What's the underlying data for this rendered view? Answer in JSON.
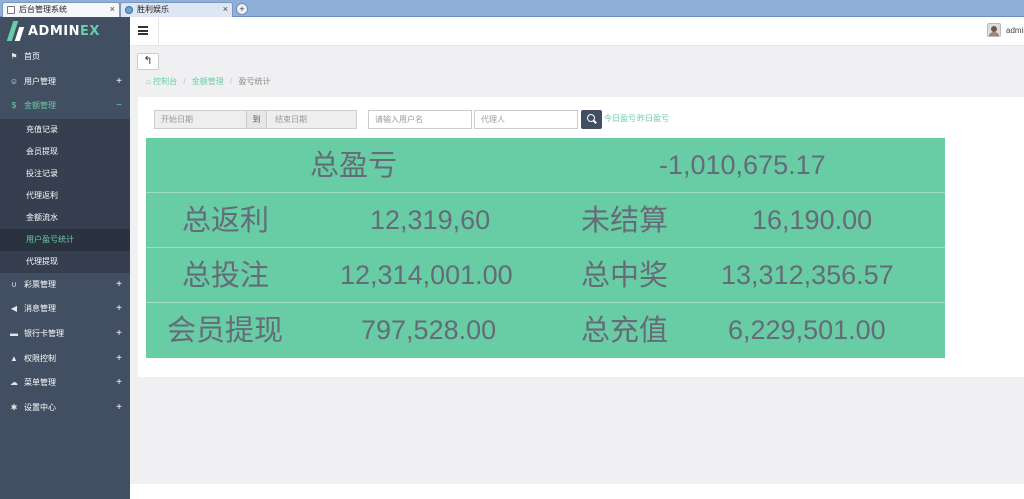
{
  "browser": {
    "tabs": [
      {
        "title": "后台管理系统",
        "close": "×"
      },
      {
        "title": "胜利娱乐",
        "close": "×"
      }
    ],
    "new_tab": "+"
  },
  "sidebar": {
    "brand": {
      "prefix": "ADMIN",
      "suffix": "EX"
    },
    "items": [
      {
        "label": "首页",
        "icon": "flag-icon",
        "glyph": "⚑",
        "expandable": false
      },
      {
        "label": "用户管理",
        "icon": "user-icon",
        "glyph": "☺",
        "expandable": true,
        "toggle": "+"
      },
      {
        "label": "金额管理",
        "icon": "dollar-icon",
        "glyph": "$",
        "expandable": true,
        "toggle": "−",
        "open": true,
        "children": [
          "充值记录",
          "会员提现",
          "投注记录",
          "代理返利",
          "金额流水",
          "用户盈亏统计",
          "代理提现"
        ],
        "active_child": "用户盈亏统计"
      },
      {
        "label": "彩票管理",
        "icon": "magnet-icon",
        "glyph": "∪",
        "expandable": true,
        "toggle": "+"
      },
      {
        "label": "消息管理",
        "icon": "bullhorn-icon",
        "glyph": "◀",
        "expandable": true,
        "toggle": "+"
      },
      {
        "label": "银行卡管理",
        "icon": "briefcase-icon",
        "glyph": "▬",
        "expandable": true,
        "toggle": "+"
      },
      {
        "label": "权限控制",
        "icon": "lock-icon",
        "glyph": "▲",
        "expandable": true,
        "toggle": "+"
      },
      {
        "label": "菜单管理",
        "icon": "cloud-icon",
        "glyph": "☁",
        "expandable": true,
        "toggle": "+"
      },
      {
        "label": "设置中心",
        "icon": "gear-icon",
        "glyph": "✱",
        "expandable": true,
        "toggle": "+"
      }
    ]
  },
  "header": {
    "username": "admin"
  },
  "breadcrumb": {
    "home_glyph": "⌂",
    "items": [
      "控制台",
      "金额管理",
      "盈亏统计"
    ],
    "separator": "/"
  },
  "toolbar": {
    "back_glyph": "↰"
  },
  "search": {
    "start_date_placeholder": "开始日期",
    "to_label": "到",
    "end_date_placeholder": "结束日期",
    "username_placeholder": "请输入用户名",
    "agent_placeholder": "代理人",
    "quick_links": [
      "今日盈亏",
      "昨日盈亏"
    ]
  },
  "stats": {
    "total_profit_label": "总盈亏",
    "total_profit_value": "-1,010,675.17",
    "rebate_label": "总返利",
    "rebate_value": "12,319,60",
    "unsettled_label": "未结算",
    "unsettled_value": "16,190.00",
    "bet_label": "总投注",
    "bet_value": "12,314,001.00",
    "win_label": "总中奖",
    "win_value": "13,312,356.57",
    "withdraw_label": "会员提现",
    "withdraw_value": "797,528.00",
    "recharge_label": "总充值",
    "recharge_value": "6,229,501.00"
  },
  "colors": {
    "sidebar_bg": "#424f63",
    "accent": "#65cea7",
    "stats_bg": "#68cca4",
    "stats_text": "#656b78"
  }
}
